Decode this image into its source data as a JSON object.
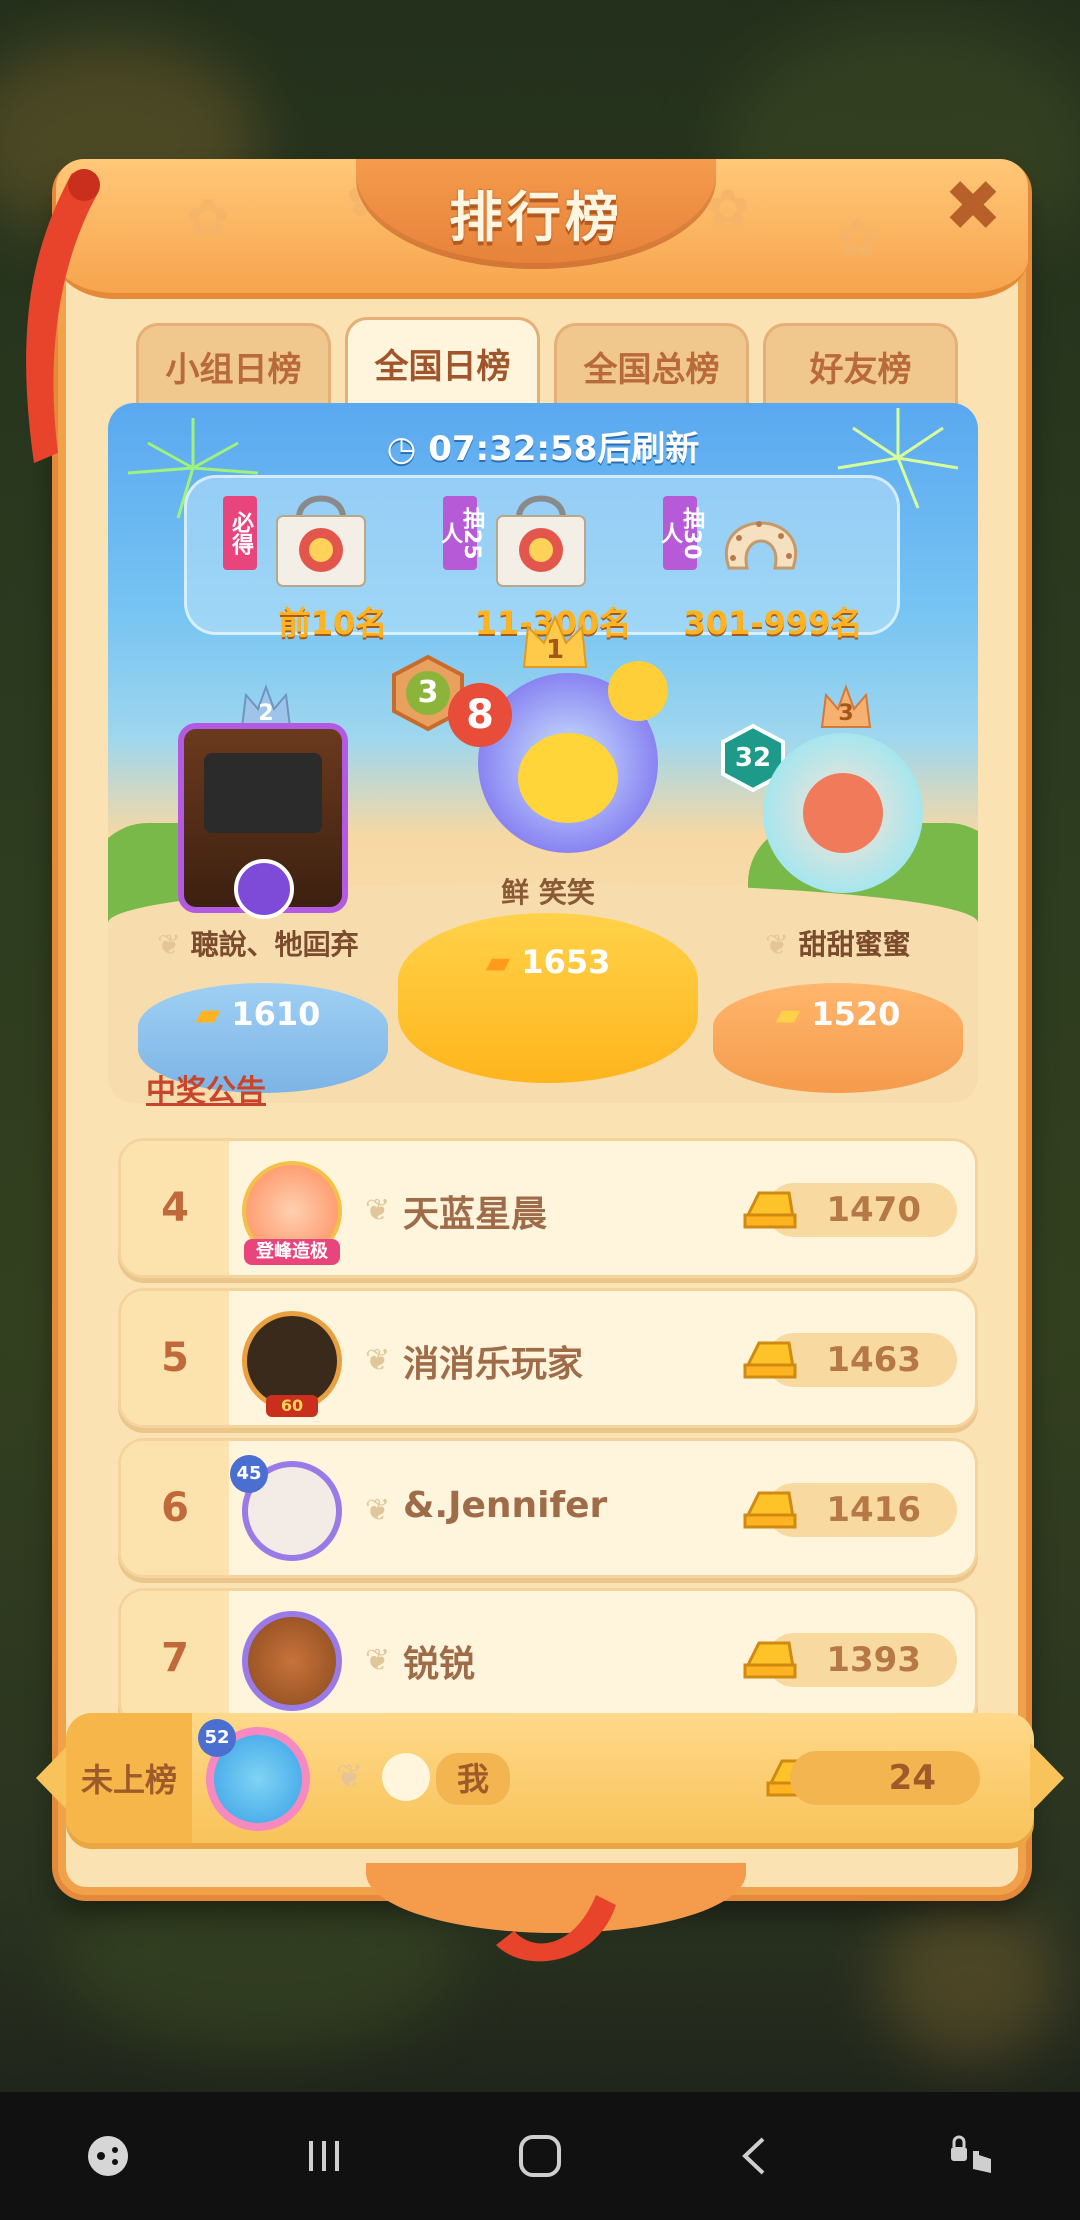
{
  "modal": {
    "title": "排行榜",
    "close_symbol": "✖"
  },
  "tabs": [
    {
      "label": "小组日榜",
      "active": false
    },
    {
      "label": "全国日榜",
      "active": true
    },
    {
      "label": "全国总榜",
      "active": false
    },
    {
      "label": "好友榜",
      "active": false
    }
  ],
  "refresh": {
    "text": "07:32:58后刷新"
  },
  "prizes": [
    {
      "badge": "必得",
      "range": "前10名"
    },
    {
      "badge": "抽25人",
      "range": "11-300名"
    },
    {
      "badge": "抽30人",
      "range": "301-999名"
    }
  ],
  "podium": {
    "first": {
      "crown_rank": "1",
      "level": "3",
      "streak": "8",
      "name": "鲜 笑笑",
      "score": "1653"
    },
    "second": {
      "crown_rank": "2",
      "name": "聴說、牠囸弃",
      "score": "1610"
    },
    "third": {
      "crown_rank": "3",
      "level": "32",
      "name": "甜甜蜜蜜",
      "score": "1520"
    }
  },
  "announce_link": "中奖公告",
  "rows": [
    {
      "rank": "4",
      "name": "天蓝星晨",
      "score": "1470",
      "avatar_tag": "登峰造极"
    },
    {
      "rank": "5",
      "name": "消消乐玩家",
      "score": "1463",
      "avatar_tag": "60"
    },
    {
      "rank": "6",
      "name": "&.Jennifer",
      "score": "1416",
      "avatar_tag": "45"
    },
    {
      "rank": "7",
      "name": "锐锐",
      "score": "1393",
      "avatar_tag": ""
    }
  ],
  "me": {
    "rank_text": "未上榜",
    "level": "52",
    "name_tag": "我",
    "score": "24"
  },
  "colors": {
    "accent": "#f59b4c",
    "gold": "#ffb320",
    "panel": "#fbe2b2",
    "sky": "#5aa8f0"
  }
}
